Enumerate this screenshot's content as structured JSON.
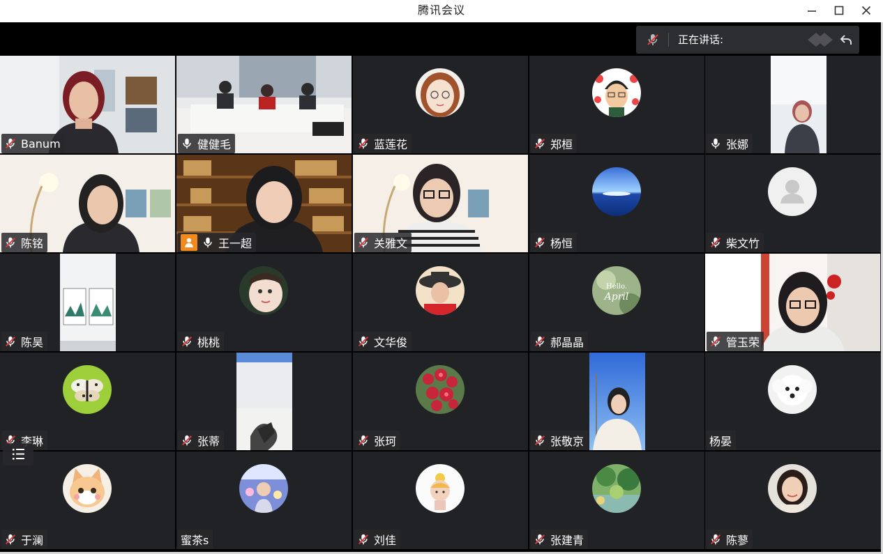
{
  "window": {
    "title": "腾讯会议"
  },
  "speaking": {
    "label": "正在讲话:"
  },
  "participants": [
    {
      "name": "Banum",
      "mic": "muted",
      "kind": "video",
      "scene": "woman-office"
    },
    {
      "name": "健健毛",
      "mic": "on",
      "kind": "video",
      "scene": "meeting-room"
    },
    {
      "name": "蓝莲花",
      "mic": "muted",
      "kind": "avatar",
      "scene": "cartoon-woman-glasses"
    },
    {
      "name": "郑桓",
      "mic": "muted",
      "kind": "avatar",
      "scene": "cartoon-boy-hearts"
    },
    {
      "name": "张娜",
      "mic": "on",
      "kind": "video-portrait",
      "scene": "woman-standing"
    },
    {
      "name": "陈铭",
      "mic": "muted",
      "kind": "video",
      "scene": "woman-lamp-room"
    },
    {
      "name": "王一超",
      "mic": "on",
      "kind": "video",
      "scene": "woman-bookshelf",
      "host": true
    },
    {
      "name": "关雅文",
      "mic": "muted",
      "kind": "video",
      "scene": "woman-glasses-stripes"
    },
    {
      "name": "杨恒",
      "mic": "muted",
      "kind": "avatar",
      "scene": "sky-sea"
    },
    {
      "name": "柴文竹",
      "mic": "muted",
      "kind": "avatar",
      "scene": "default-person"
    },
    {
      "name": "陈昊",
      "mic": "muted",
      "kind": "video-portrait",
      "scene": "wall-paintings"
    },
    {
      "name": "桃桃",
      "mic": "muted",
      "kind": "avatar",
      "scene": "baby-doll"
    },
    {
      "name": "文华俊",
      "mic": "muted",
      "kind": "avatar",
      "scene": "woman-hat"
    },
    {
      "name": "郝晶晶",
      "mic": "muted",
      "kind": "avatar",
      "scene": "hello-april"
    },
    {
      "name": "管玉荣",
      "mic": "muted",
      "kind": "video",
      "scene": "woman-glasses-window"
    },
    {
      "name": "李琳",
      "mic": "muted",
      "kind": "avatar",
      "scene": "butterfly"
    },
    {
      "name": "张蒂",
      "mic": "muted",
      "kind": "video-portrait",
      "scene": "room-snow"
    },
    {
      "name": "张珂",
      "mic": "muted",
      "kind": "avatar",
      "scene": "red-flowers"
    },
    {
      "name": "张敬京",
      "mic": "muted",
      "kind": "video-portrait",
      "scene": "woman-blue-sky"
    },
    {
      "name": "杨晏",
      "mic": "none",
      "kind": "avatar",
      "scene": "white-dog"
    },
    {
      "name": "于澜",
      "mic": "muted",
      "kind": "avatar",
      "scene": "cat"
    },
    {
      "name": "蜜茶s",
      "mic": "none",
      "kind": "avatar",
      "scene": "girl-photo"
    },
    {
      "name": "刘佳",
      "mic": "muted",
      "kind": "avatar",
      "scene": "cartoon-girl"
    },
    {
      "name": "张建青",
      "mic": "muted",
      "kind": "avatar",
      "scene": "garden"
    },
    {
      "name": "陈蓼",
      "mic": "muted",
      "kind": "avatar",
      "scene": "woman-smile"
    }
  ],
  "colors": {
    "stage": "#000000",
    "tile": "#212226",
    "mic_muted": "#e0393e",
    "host": "#f08a1c"
  }
}
